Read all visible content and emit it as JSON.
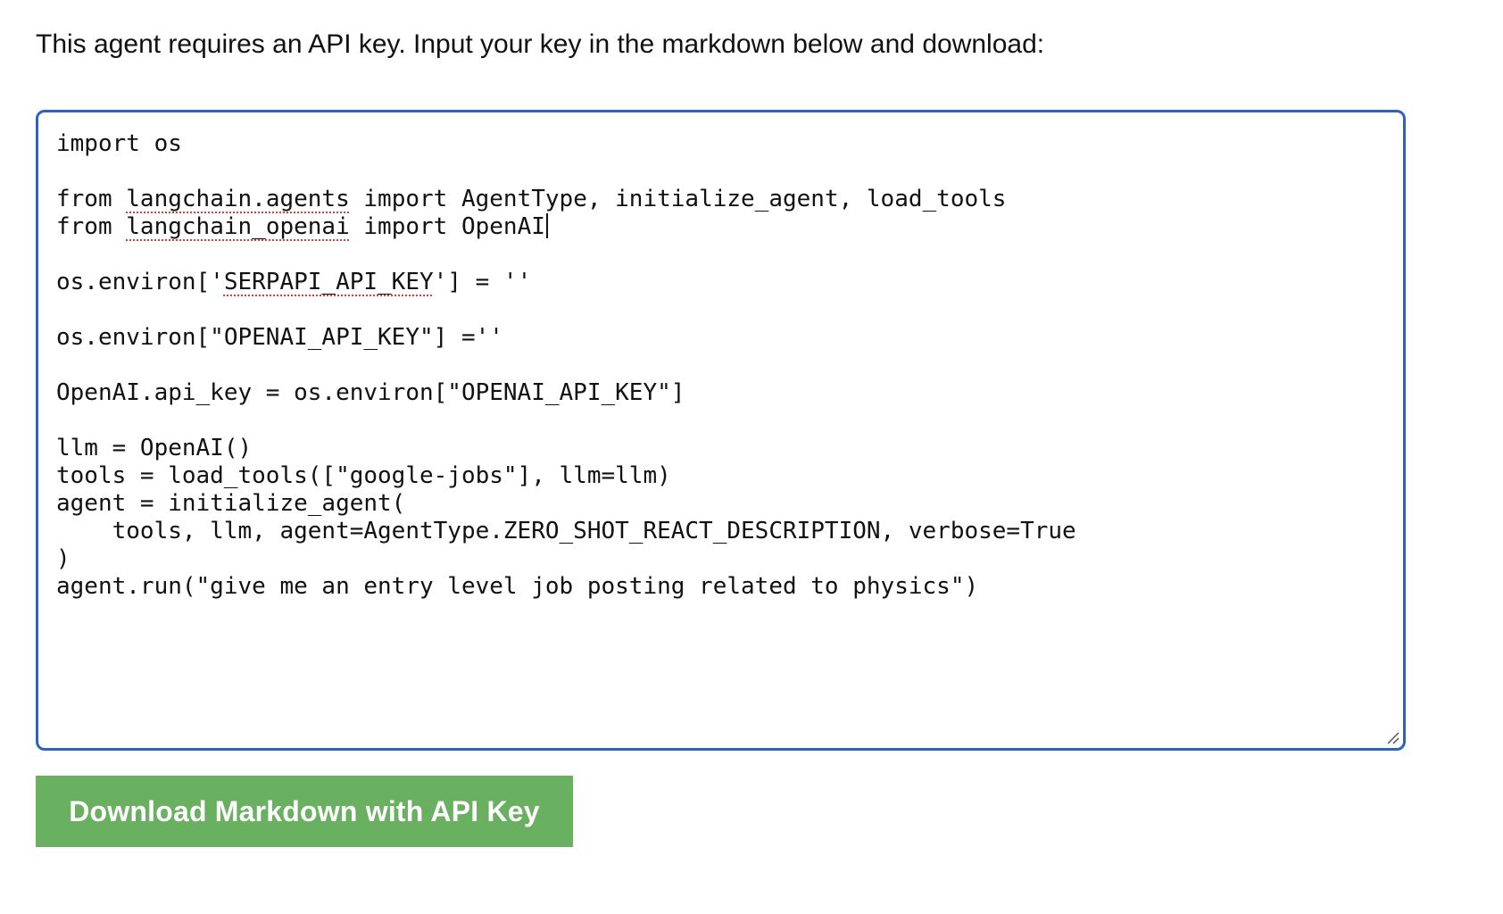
{
  "instruction_text": "This agent requires an API key. Input your key in the markdown below and download:",
  "editor": {
    "lines": [
      [
        {
          "t": "import os"
        }
      ],
      [],
      [
        {
          "t": "from "
        },
        {
          "t": "langchain.agents",
          "sq": true
        },
        {
          "t": " import AgentType, initialize_agent, load_tools"
        }
      ],
      [
        {
          "t": "from "
        },
        {
          "t": "langchain_openai",
          "sq": true
        },
        {
          "t": " import OpenAI"
        },
        {
          "caret": true
        }
      ],
      [],
      [
        {
          "t": "os.environ['"
        },
        {
          "t": "SERPAPI_API_KEY",
          "sq": true
        },
        {
          "t": "'] = ''"
        }
      ],
      [],
      [
        {
          "t": "os.environ[\"OPENAI_API_KEY\"] =''"
        }
      ],
      [],
      [
        {
          "t": "OpenAI.api_key = os.environ[\"OPENAI_API_KEY\"]"
        }
      ],
      [],
      [
        {
          "t": "llm = OpenAI()"
        }
      ],
      [
        {
          "t": "tools = load_tools([\"google-jobs\"], llm=llm)"
        }
      ],
      [
        {
          "t": "agent = initialize_agent("
        }
      ],
      [
        {
          "t": "    tools, llm, agent=AgentType.ZERO_SHOT_REACT_DESCRIPTION, verbose=True"
        }
      ],
      [
        {
          "t": ")"
        }
      ],
      [
        {
          "t": "agent.run(\"give me an entry level job posting related to physics\")"
        }
      ]
    ]
  },
  "download_button_label": "Download Markdown with API Key",
  "colors": {
    "editor_border": "#2f62c0",
    "button_background": "#69b060",
    "spellcheck_underline": "#e23a3a"
  },
  "icons": {
    "resize_handle": "resize-grip-icon"
  }
}
